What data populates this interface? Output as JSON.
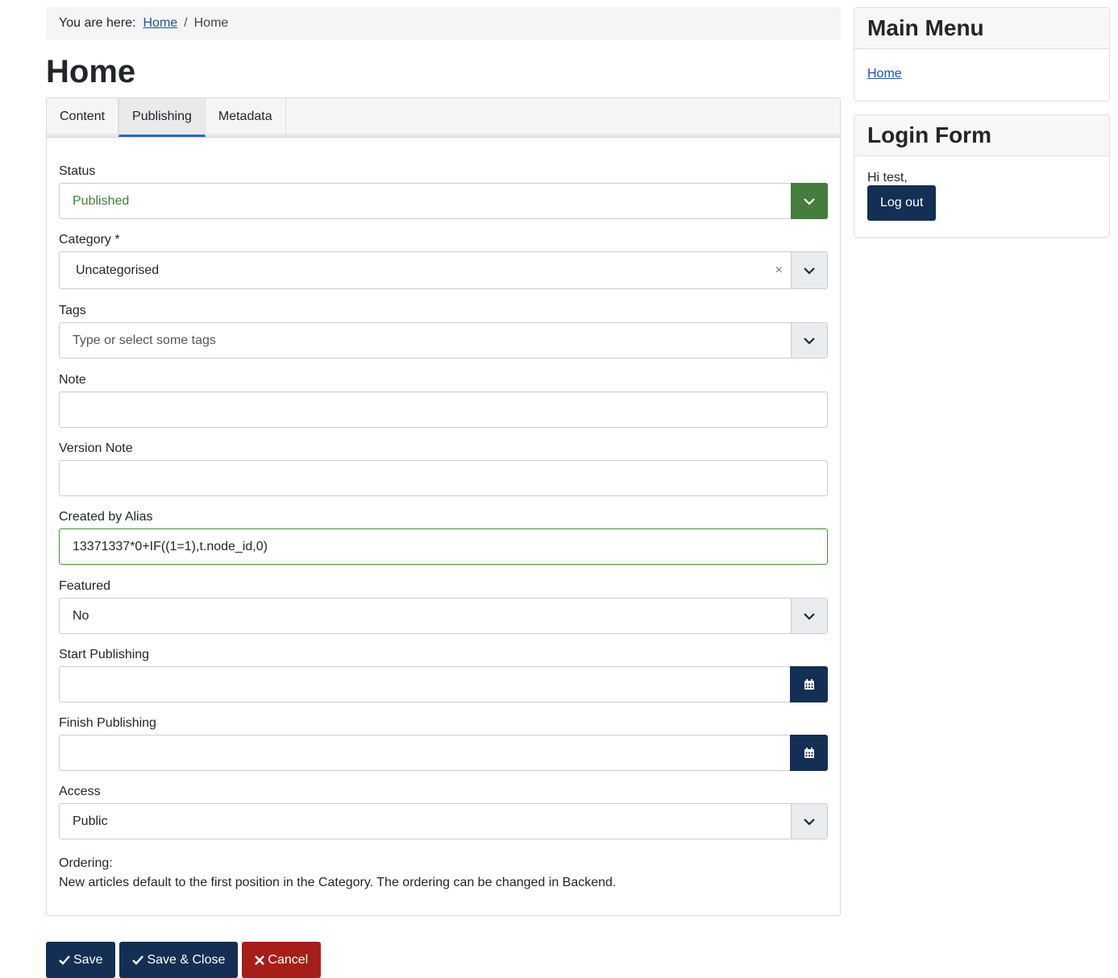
{
  "breadcrumb": {
    "prefix": "You are here:",
    "home_link": "Home",
    "separator": "/",
    "current": "Home"
  },
  "page_title": "Home",
  "tabs": [
    {
      "label": "Content",
      "active": false
    },
    {
      "label": "Publishing",
      "active": true
    },
    {
      "label": "Metadata",
      "active": false
    }
  ],
  "form": {
    "status": {
      "label": "Status",
      "value": "Published"
    },
    "category": {
      "label": "Category *",
      "value": "Uncategorised",
      "clear": "×"
    },
    "tags": {
      "label": "Tags",
      "placeholder": "Type or select some tags"
    },
    "note": {
      "label": "Note",
      "value": ""
    },
    "version_note": {
      "label": "Version Note",
      "value": ""
    },
    "created_by_alias": {
      "label": "Created by Alias",
      "value": "13371337*0+IF((1=1),t.node_id,0)"
    },
    "featured": {
      "label": "Featured",
      "value": "No"
    },
    "start_publishing": {
      "label": "Start Publishing",
      "value": ""
    },
    "finish_publishing": {
      "label": "Finish Publishing",
      "value": ""
    },
    "access": {
      "label": "Access",
      "value": "Public"
    },
    "ordering": {
      "label": "Ordering:",
      "text": "New articles default to the first position in the Category. The ordering can be changed in Backend."
    }
  },
  "actions": {
    "save": "Save",
    "save_close": "Save & Close",
    "cancel": "Cancel"
  },
  "sidebar": {
    "main_menu": {
      "title": "Main Menu",
      "items": [
        "Home"
      ]
    },
    "login_form": {
      "title": "Login Form",
      "greeting": "Hi test,",
      "logout": "Log out"
    }
  },
  "colors": {
    "primary": "#132f53",
    "danger": "#a51f18",
    "status_green": "#457d3c",
    "link": "#224faa",
    "tab_active_underline": "#2a69b8"
  }
}
